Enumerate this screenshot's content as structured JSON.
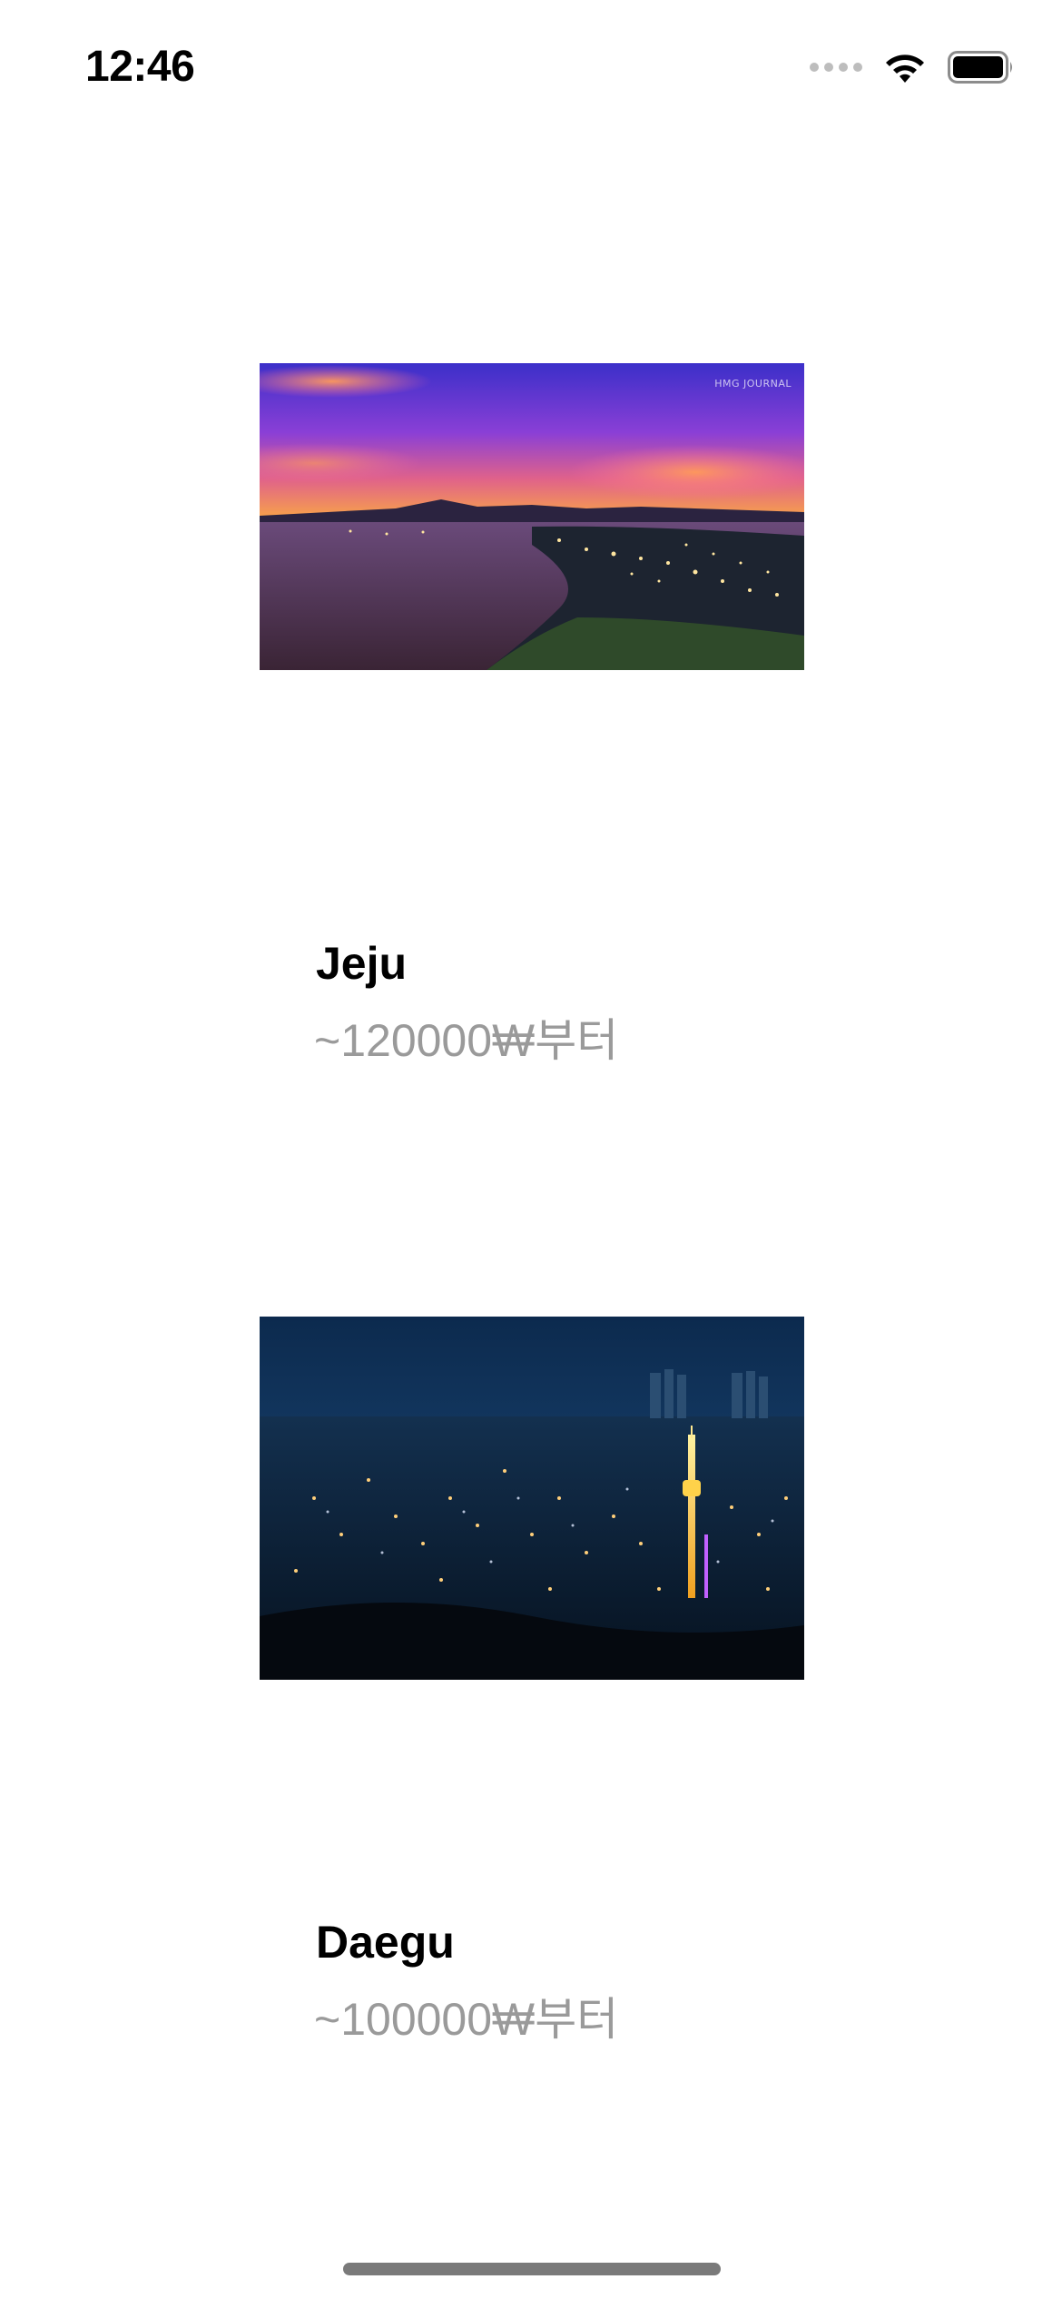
{
  "status_bar": {
    "time": "12:46",
    "icons": [
      "cellular-signal-icon",
      "wifi-icon",
      "battery-icon"
    ]
  },
  "destinations": [
    {
      "name": "Jeju",
      "price_text": "~120000₩부터",
      "image": {
        "description_icon": "photo-jeju-coast-sunset",
        "watermark": "HMG JOURNAL"
      }
    },
    {
      "name": "Daegu",
      "price_text": "~100000₩부터",
      "image": {
        "description_icon": "photo-daegu-night-tower"
      }
    }
  ],
  "colors": {
    "title": "#000000",
    "price": "#9a9a9a",
    "background": "#ffffff"
  }
}
